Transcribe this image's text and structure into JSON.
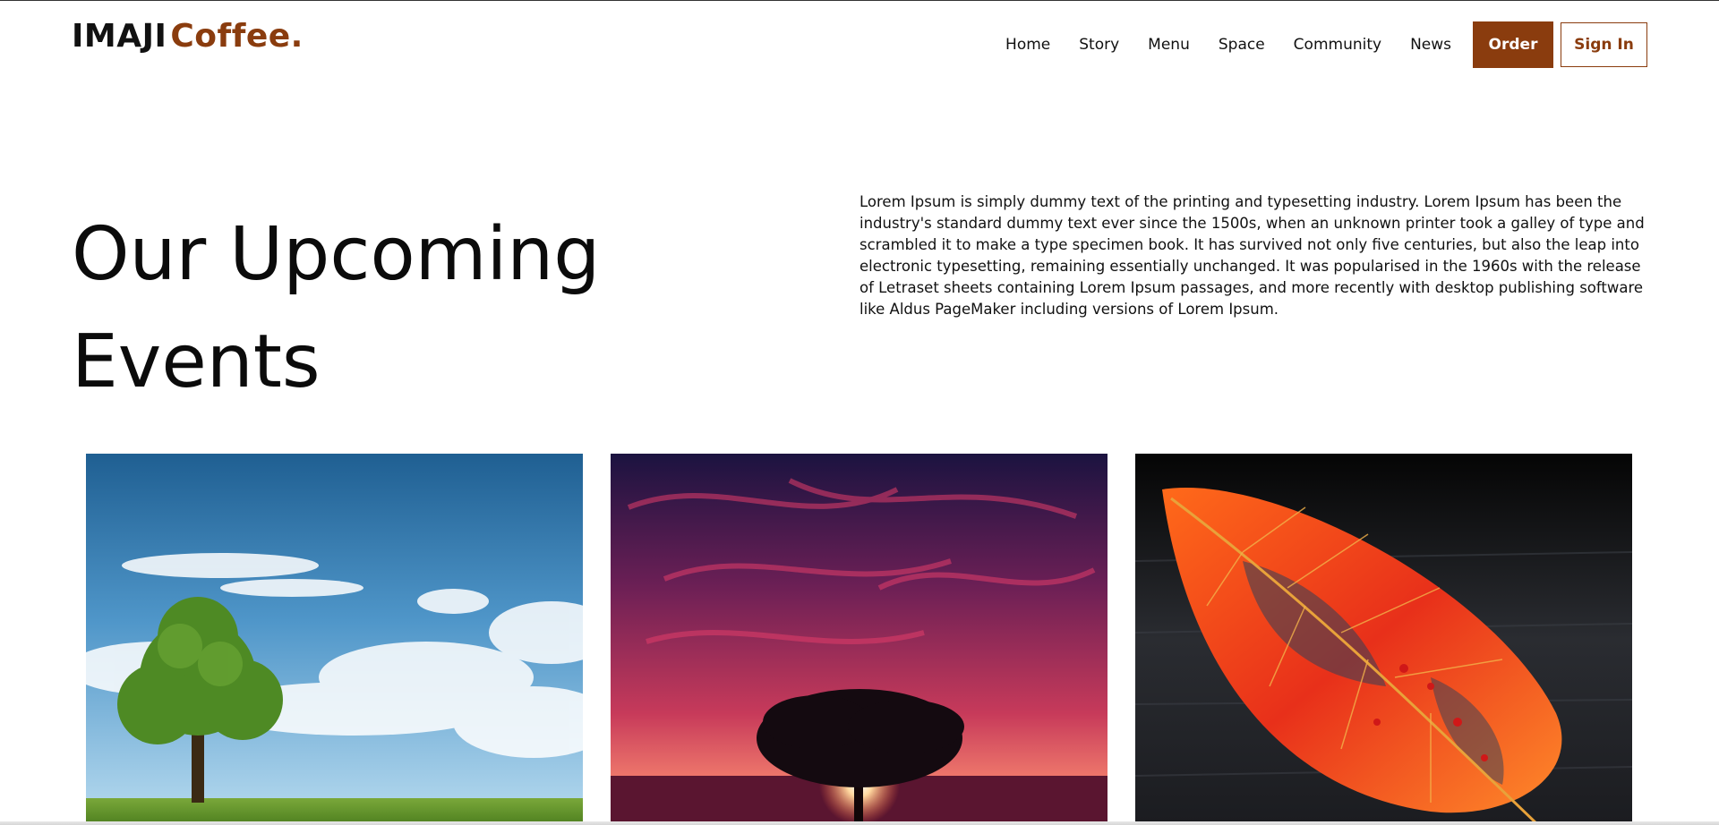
{
  "header": {
    "logo": {
      "brand_part1": "IMAJI",
      "brand_part2": "Coffee."
    },
    "nav": [
      {
        "label": "Home"
      },
      {
        "label": "Story"
      },
      {
        "label": "Menu"
      },
      {
        "label": "Space"
      },
      {
        "label": "Community"
      },
      {
        "label": "News"
      }
    ],
    "order_label": "Order",
    "signin_label": "Sign In"
  },
  "hero": {
    "title_line1": "Our Upcoming",
    "title_line2": "Events",
    "description": "Lorem Ipsum is simply dummy text of the printing and typesetting industry. Lorem Ipsum has been the industry's standard dummy text ever since the 1500s, when an unknown printer took a galley of type and scrambled it to make a type specimen book. It has survived not only five centuries, but also the leap into electronic typesetting, remaining essentially unchanged. It was popularised in the 1960s with the release of Letraset sheets containing Lorem Ipsum passages, and more recently with desktop publishing software like Aldus PageMaker including versions of Lorem Ipsum."
  },
  "events": [
    {
      "image": "tree-field-blue-sky"
    },
    {
      "image": "tree-sunset-red-sky"
    },
    {
      "image": "red-autumn-leaf"
    }
  ],
  "colors": {
    "accent": "#8a3c0e",
    "text": "#111111",
    "background": "#ffffff"
  }
}
